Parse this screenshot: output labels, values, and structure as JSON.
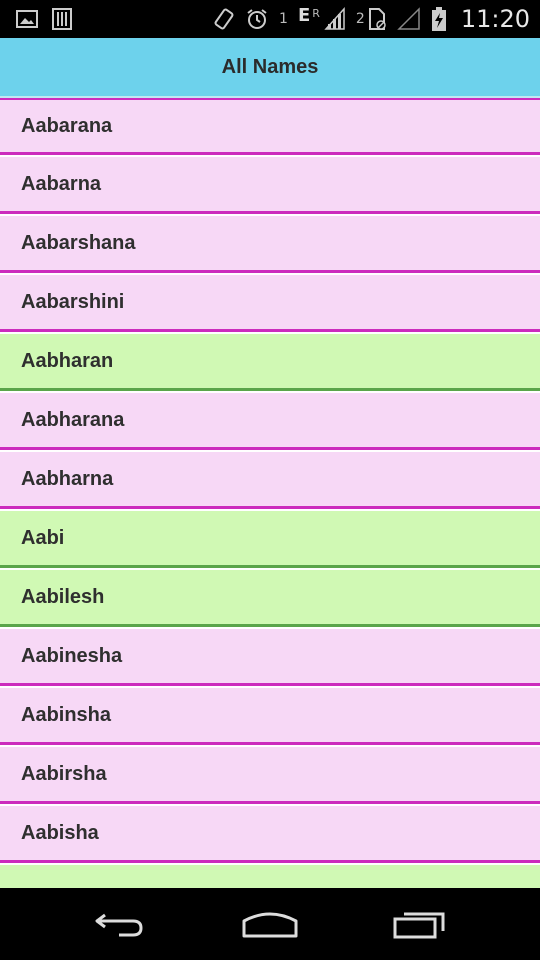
{
  "status_bar": {
    "sim_slot_1": "1",
    "network_type": "E",
    "roaming_indicator": "R",
    "sim_slot_2": "2",
    "time": "11:20",
    "icons": [
      "image-icon",
      "barcode-icon",
      "screen-rotation-icon",
      "alarm-icon",
      "signal-icon",
      "sim-card-icon",
      "signal-empty-icon",
      "battery-charging-icon"
    ]
  },
  "action_bar": {
    "title": "All Names"
  },
  "names": [
    {
      "label": "Aabarana",
      "style": "pink"
    },
    {
      "label": "Aabarna",
      "style": "pink"
    },
    {
      "label": "Aabarshana",
      "style": "pink"
    },
    {
      "label": "Aabarshini",
      "style": "pink"
    },
    {
      "label": "Aabharan",
      "style": "green"
    },
    {
      "label": "Aabharana",
      "style": "pink"
    },
    {
      "label": "Aabharna",
      "style": "pink"
    },
    {
      "label": "Aabi",
      "style": "green"
    },
    {
      "label": "Aabilesh",
      "style": "green"
    },
    {
      "label": "Aabinesha",
      "style": "pink"
    },
    {
      "label": "Aabinsha",
      "style": "pink"
    },
    {
      "label": "Aabirsha",
      "style": "pink"
    },
    {
      "label": "Aabisha",
      "style": "pink"
    },
    {
      "label": "",
      "style": "green"
    }
  ],
  "colors": {
    "action_bar": "#6dd2ec",
    "row_pink": "#f7d8f6",
    "row_green": "#d0f9b4",
    "divider_magenta": "#cc2bbd"
  },
  "nav_bar": {
    "icons": [
      "back-icon",
      "home-icon",
      "recent-apps-icon"
    ]
  }
}
